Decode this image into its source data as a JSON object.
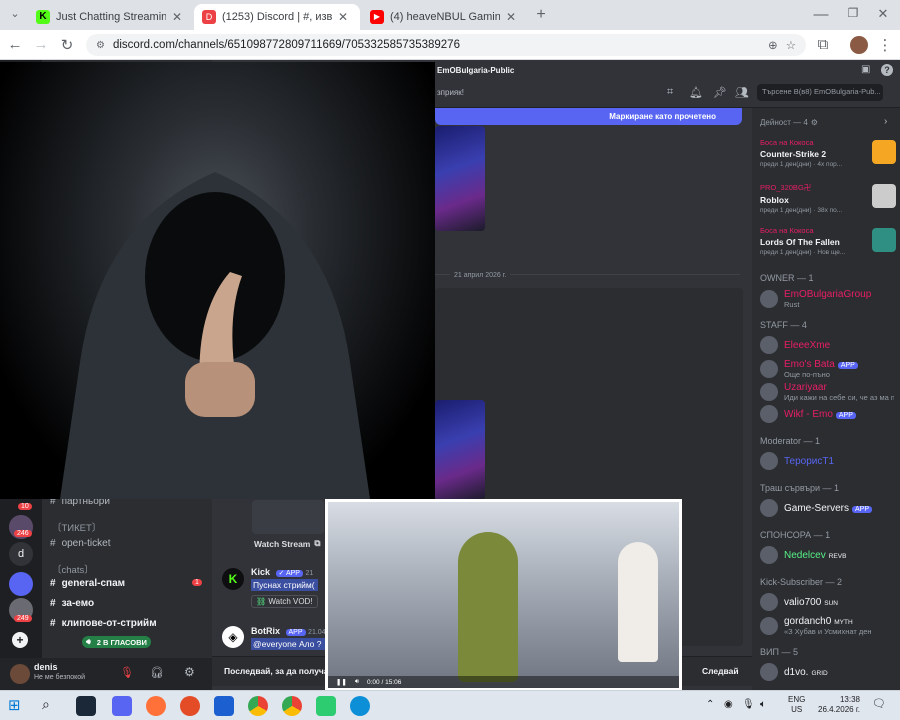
{
  "browser": {
    "tabs": [
      {
        "title": "Just Chatting Streaming - Live S",
        "fav_color": "#53fc18",
        "fav_glyph": "K"
      },
      {
        "title": "(1253) Discord | #, извести",
        "fav_color": "#ed4245",
        "fav_glyph": "D",
        "active": true
      },
      {
        "title": "(4) heaveNBUL Gaming - YouTub",
        "fav_color": "#ff0000",
        "fav_glyph": "▶"
      }
    ],
    "url": "discord.com/channels/651098772809711669/705332585735389276",
    "window_controls": {
      "minimize": "—",
      "maximize": "❐",
      "close": "✕"
    }
  },
  "discord": {
    "server_name": "EmOBulgaria-Public",
    "channel_topic_snippet": "зприяк!",
    "search_placeholder": "Търсене В(в8) EmOBulgaria-Pub...",
    "mark_read_label": "Маркиране като прочетено",
    "date_divider": "21 април 2026 г.",
    "watch_stream": "Watch Stream",
    "follow_label": "Следвай",
    "follow_prompt": "Последвай, за да получа",
    "messages": [
      {
        "author": "Kick",
        "badge": "✓ APP",
        "time": "21",
        "text": "Пуснах стрийм(",
        "link": "Watch VOD!"
      },
      {
        "author": "BotRix",
        "badge": "APP",
        "time": "21.04.2",
        "text": "@everyone Ало ?"
      }
    ],
    "server_badges": [
      "10",
      "246",
      "249"
    ],
    "categories": [
      {
        "label": "〔ТИКЕТ〕",
        "channels": [
          {
            "name": "open-ticket"
          }
        ]
      },
      {
        "label": "〔chats〕",
        "channels": [
          {
            "name": "general-спам",
            "bold": true,
            "mention": "1"
          },
          {
            "name": "за-емо",
            "bold": true
          },
          {
            "name": "клипове-от-стрийм",
            "bold": true
          },
          {
            "name": "2 В ГЛАСОВИ",
            "voice": true
          }
        ]
      }
    ],
    "top_channel": "партньори",
    "user": {
      "name": "denis",
      "status": "Не ме безпокой"
    },
    "activity": {
      "title": "Дейност — 4",
      "items": [
        {
          "user": "Боса на Кокоса",
          "game": "Counter-Strike 2",
          "meta": "преди 1 ден(дни) · 4х пор...",
          "color": "#f5a623"
        },
        {
          "user": "PRO_320BG卍",
          "game": "Roblox",
          "meta": "преди 1 ден(дни) · 38х по...",
          "color": "#cccccc"
        },
        {
          "user": "Боса на Кокоса",
          "game": "Lords Of The Fallen",
          "meta": "преди 1 ден(дни) · Нов ще...",
          "color": "#2f8f82"
        }
      ]
    },
    "member_sections": [
      {
        "title": "OWNER — 1",
        "members": [
          {
            "name": "EmOBulgariaGroup",
            "sub": "Rust",
            "color": "#e91e63"
          }
        ]
      },
      {
        "title": "STAFF — 4",
        "members": [
          {
            "name": "EleeeXme",
            "sub": "",
            "color": "#e91e63"
          },
          {
            "name": "Emo's Bata",
            "sub": "Още по-пъно",
            "color": "#e91e63",
            "badge": "APP"
          },
          {
            "name": "Uzariyaar",
            "sub": "Иди кажи на себе си, че аз ма пр...",
            "color": "#e91e63"
          },
          {
            "name": "Wikf - Emo",
            "sub": "",
            "color": "#e91e63",
            "badge": "APP"
          }
        ]
      },
      {
        "title": "Moderator — 1",
        "members": [
          {
            "name": "ТерорисТ1",
            "sub": "",
            "color": "#5865f2"
          }
        ]
      },
      {
        "title": "Траш сървъри — 1",
        "members": [
          {
            "name": "Game-Servers",
            "sub": "",
            "color": "#f2f3f5",
            "badge": "APP"
          }
        ]
      },
      {
        "title": "СПОНСОРА — 1",
        "members": [
          {
            "name": "Nedelcev",
            "sub": "",
            "color": "#57f287",
            "tag": "REVB"
          }
        ]
      },
      {
        "title": "Kick-Subscriber — 2",
        "members": [
          {
            "name": "valio700",
            "sub": "",
            "color": "#f2f3f5",
            "tag": "SUN"
          },
          {
            "name": "gordanch0",
            "sub": "«З Хубав и Усмихнат ден",
            "color": "#f2f3f5",
            "tag": "MYTH"
          }
        ]
      },
      {
        "title": "ВИП — 5",
        "members": [
          {
            "name": "d1vo.",
            "sub": "",
            "color": "#f2f3f5",
            "tag": "GRID"
          }
        ]
      }
    ]
  },
  "video_player": {
    "time": "0:00 / 15:06"
  },
  "taskbar": {
    "lang": "ENG",
    "region": "US",
    "time": "13:38",
    "date": "26.4.2026 г."
  }
}
